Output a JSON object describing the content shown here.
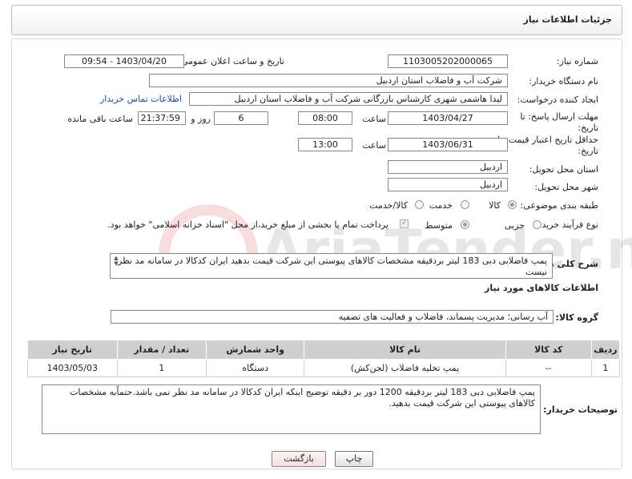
{
  "header": {
    "title": "جزئیات اطلاعات نیاز"
  },
  "labels": {
    "need_number": "شماره نیاز:",
    "announce_datetime": "تاریخ و ساعت اعلان عمومی:",
    "buyer_org": "نام دستگاه خریدار:",
    "requester": "ایجاد کننده درخواست:",
    "reply_deadline_1": "مهلت ارسال پاسخ: تا",
    "reply_deadline_2": "تاریخ:",
    "time_word": "ساعت",
    "days_word": "روز و",
    "remaining_word": "ساعت باقی مانده",
    "price_validity_1": "حداقل تاریخ اعتبار قیمت: تا",
    "price_validity_2": "تاریخ:",
    "delivery_province": "استان محل تحویل:",
    "delivery_city": "شهر محل تحویل:",
    "category": "طبقه بندی موضوعی:",
    "purchase_type": "نوع فرآیند خرید :",
    "general_desc": "شرح کلی نیاز:",
    "goods_info": "اطلاعات کالاهای مورد نیاز",
    "goods_group": "گروه کالا:",
    "buyer_notes": "توضیحات خریدار:"
  },
  "values": {
    "need_number": "1103005202000065",
    "announce_datetime": "1403/04/20 - 09:54",
    "buyer_org": "شرکت آب و فاضلاب استان اردبیل",
    "requester": "لیدا  هاشمی شهری کارشناس بازرگانی شرکت آب و فاضلاب استان اردبیل",
    "buyer_contact_link": "اطلاعات تماس خریدار",
    "reply_date": "1403/04/27",
    "reply_time": "08:00",
    "remaining_days": "6",
    "remaining_time": "21:37:59",
    "validity_date": "1403/06/31",
    "validity_time": "13:00",
    "province": "اردبیل",
    "city": "اردبیل",
    "goods_group": "آب رسانی؛ مدیریت پسماند، فاضلاب و فعالیت های تصفیه"
  },
  "category_options": [
    {
      "label": "کالا",
      "selected": true
    },
    {
      "label": "خدمت",
      "selected": false
    },
    {
      "label": "کالا/خدمت",
      "selected": false
    }
  ],
  "purchase_options": [
    {
      "label": "جزیی",
      "selected": false
    },
    {
      "label": "متوسط",
      "selected": true
    }
  ],
  "payment_note": "پرداخت تمام یا بخشی از مبلغ خرید،از محل \"اسناد خزانه اسلامی\" خواهد بود.",
  "general_desc_text": "پمپ فاضلابی دبی 183 لیتر بردقیقه مشخصات کالاهای پیوستی این شرکت قیمت بدهید  ایران کدکالا در سامانه مد نظر نیست",
  "table": {
    "headers": [
      "ردیف",
      "کد کالا",
      "نام کالا",
      "واحد شمارش",
      "تعداد / مقدار",
      "تاریخ نیاز"
    ],
    "rows": [
      [
        "1",
        "--",
        "پمپ تخلیه فاضلاب (لجن‌کش)",
        "دستگاه",
        "1",
        "1403/05/03"
      ]
    ]
  },
  "buyer_notes_text": "پمپ فاضلابی دبی 183 لیتر بردقیقه 1200 دور بر دقیقه توضیح اینکه ایران کدکالا در سامانه مد نظر نمی باشد.حتماًبه مشخصات کالاهای پیوستی این شرکت قیمت بدهید.",
  "buttons": {
    "print": "چاپ",
    "back": "بازگشت"
  },
  "watermark_text": "AriaTender.neT"
}
